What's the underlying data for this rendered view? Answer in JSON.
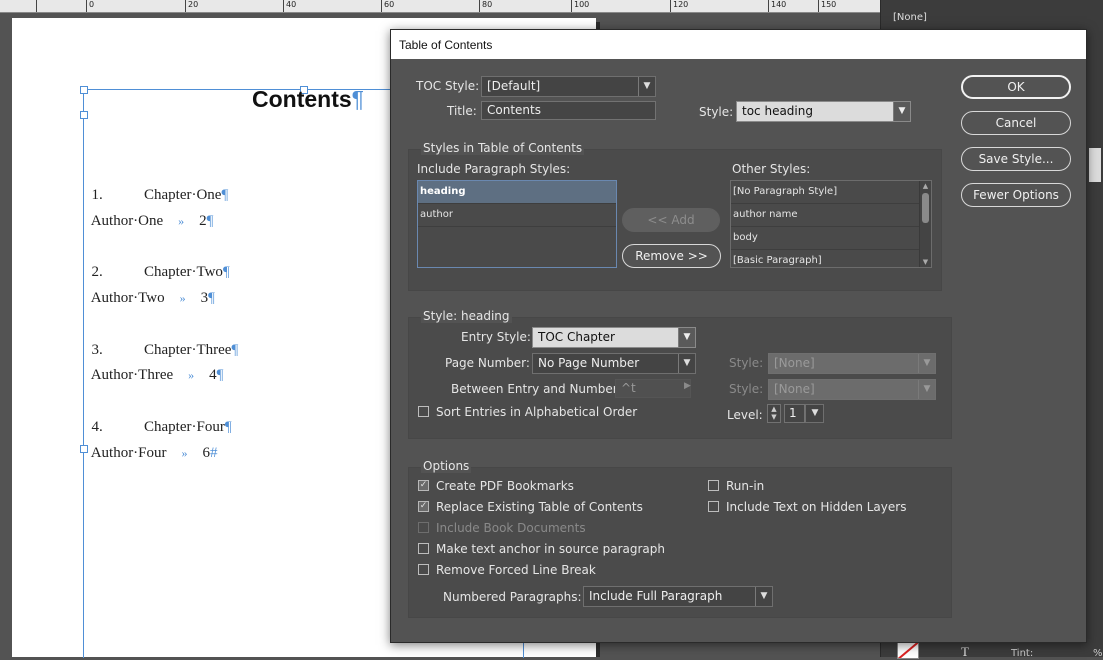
{
  "ruler": {
    "ticks": [
      "0",
      "20",
      "40",
      "60",
      "80",
      "100",
      "120",
      "140",
      "150"
    ]
  },
  "document": {
    "title": "Contents",
    "pilcrow": "¶",
    "hash_end": "#",
    "entries": [
      {
        "chapter": "1.\t\tChapter·One",
        "author": "Author·One",
        "arrow": "»",
        "page": "2"
      },
      {
        "chapter": "2.\t\tChapter·Two",
        "author": "Author·Two",
        "arrow": "»",
        "page": "3"
      },
      {
        "chapter": "3.\t\tChapter·Three",
        "author": "Author·Three",
        "arrow": "»",
        "page": "4"
      },
      {
        "chapter": "4.\t\tChapter·Four",
        "author": "Author·Four",
        "arrow": "»",
        "page": "6"
      }
    ]
  },
  "right_panel": {
    "swatch_none": "[None]",
    "tint_label": "Tint:",
    "pct": "%",
    "t_glyph": "T"
  },
  "dialog": {
    "title": "Table of Contents",
    "toc_style_label": "TOC Style:",
    "toc_style_value": "[Default]",
    "title_label": "Title:",
    "title_value": "Contents",
    "style_label": "Style:",
    "style_value": "toc heading",
    "buttons": {
      "ok": "OK",
      "cancel": "Cancel",
      "save_style": "Save Style...",
      "fewer_options": "Fewer Options"
    },
    "styles_group": {
      "title": "Styles in Table of Contents",
      "include_label": "Include Paragraph Styles:",
      "include_items": [
        "heading",
        "author"
      ],
      "add_label": "<< Add",
      "remove_label": "Remove >>",
      "other_label": "Other Styles:",
      "other_items": [
        "[No Paragraph Style]",
        "author name",
        "body",
        "[Basic Paragraph]"
      ]
    },
    "style_heading_group": {
      "title": "Style: heading",
      "entry_style_label": "Entry Style:",
      "entry_style_value": "TOC Chapter",
      "page_number_label": "Page Number:",
      "page_number_value": "No Page Number",
      "between_label": "Between Entry and Number:",
      "between_value": "^t",
      "style1_label": "Style:",
      "style1_value": "[None]",
      "style2_label": "Style:",
      "style2_value": "[None]",
      "sort_label": "Sort Entries in Alphabetical Order",
      "level_label": "Level:",
      "level_value": "1"
    },
    "options_group": {
      "title": "Options",
      "create_pdf_bookmarks": "Create PDF Bookmarks",
      "replace_existing": "Replace Existing Table of Contents",
      "include_book_docs": "Include Book Documents",
      "make_anchor": "Make text anchor in source paragraph",
      "remove_forced": "Remove Forced Line Break",
      "run_in": "Run-in",
      "include_hidden": "Include Text on Hidden Layers",
      "numbered_label": "Numbered Paragraphs:",
      "numbered_value": "Include Full Paragraph"
    }
  }
}
